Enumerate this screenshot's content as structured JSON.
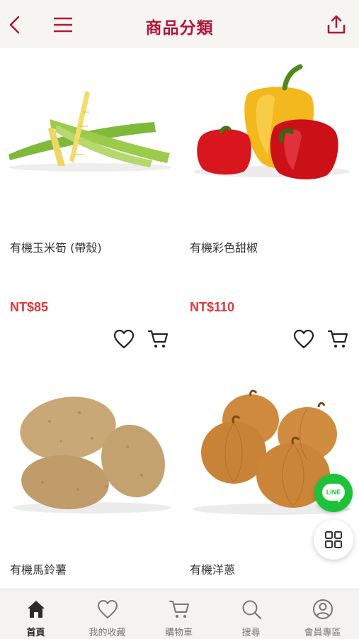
{
  "header": {
    "title": "商品分類",
    "back_icon": "chevron-left-icon",
    "menu_icon": "hamburger-menu-icon",
    "share_icon": "share-upload-icon",
    "accent_color": "#b3163a"
  },
  "products": [
    {
      "name": "有機玉米筍 (帶殼)",
      "price": "NT$85",
      "image": "baby-corn-image"
    },
    {
      "name": "有機彩色甜椒",
      "price": "NT$110",
      "image": "bell-peppers-image"
    },
    {
      "name": "有機馬鈴薯",
      "image": "potatoes-image"
    },
    {
      "name": "有機洋蔥",
      "image": "onions-image"
    }
  ],
  "floating": {
    "line_label": "LINE",
    "grid_icon": "grid-icon"
  },
  "tabbar": {
    "items": [
      {
        "label": "首頁",
        "icon": "home-icon",
        "active": true
      },
      {
        "label": "我的收藏",
        "icon": "heart-icon"
      },
      {
        "label": "購物車",
        "icon": "cart-icon"
      },
      {
        "label": "搜尋",
        "icon": "search-icon"
      },
      {
        "label": "會員專區",
        "icon": "user-icon"
      }
    ]
  },
  "colors": {
    "price": "#e0373c",
    "line_green": "#1dc239"
  }
}
